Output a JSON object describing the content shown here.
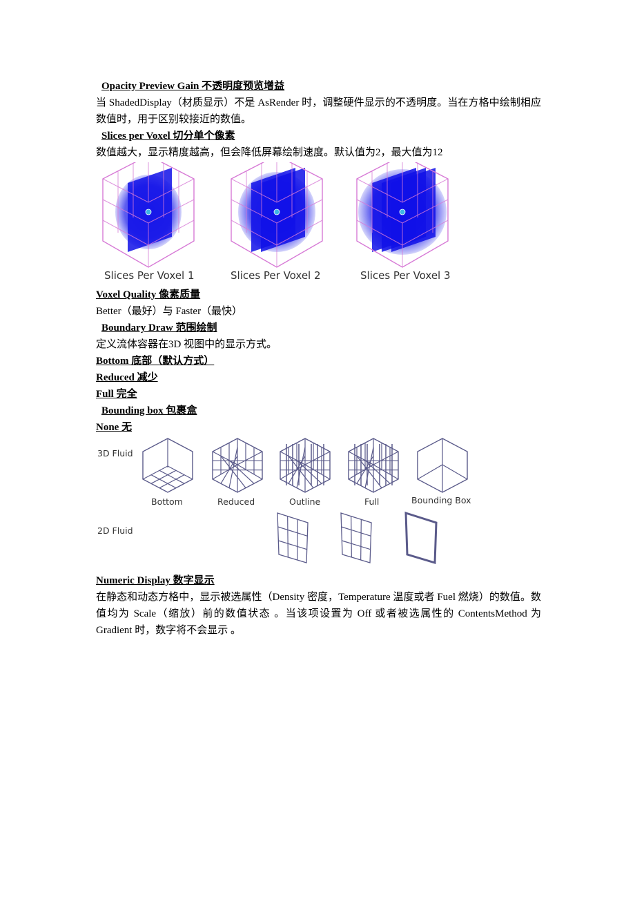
{
  "sections": {
    "opacity_gain": {
      "heading": "Opacity Preview Gain  不透明度预览增益",
      "text": "当 ShadedDisplay（材质显示）不是 AsRender 时，调整硬件显示的不透明度。当在方格中绘制相应数值时，用于区别较接近的数值。"
    },
    "slices_per_voxel": {
      "heading": "Slices per Voxel  切分单个像素",
      "text": "数值越大，显示精度越高，但会降低屏幕绘制速度。默认值为2，最大值为12"
    },
    "voxel_quality": {
      "heading": "Voxel Quality  像素质量",
      "text": "Better（最好）与 Faster（最快）"
    },
    "boundary_draw": {
      "heading": "Boundary Draw 范围绘制",
      "text": "定义流体容器在3D 视图中的显示方式。",
      "options": [
        "Bottom  底部（默认方式）",
        "Reduced  减少",
        "Full  完全",
        "Bounding box  包裹盒",
        "None  无"
      ]
    },
    "numeric_display": {
      "heading": "Numeric Display  数字显示",
      "text": "在静态和动态方格中，显示被选属性（Density 密度，Temperature 温度或者 Fuel 燃烧）的数值。数值均为 Scale（缩放）前的数值状态 。当该项设置为 Off 或者被选属性的 ContentsMethod 为 Gradient 时，数字将不会显示 。"
    }
  },
  "figure_slices": {
    "captions": [
      "Slices Per Voxel 1",
      "Slices Per Voxel 2",
      "Slices Per Voxel 3"
    ],
    "slice_counts": [
      1,
      2,
      3
    ],
    "colors": {
      "cage": "#d77ad6",
      "volume": "#1010e8",
      "center": "#3fb6e6"
    }
  },
  "figure_boundary": {
    "row_labels": [
      "3D Fluid",
      "2D Fluid"
    ],
    "captions": [
      "Bottom",
      "Reduced",
      "Outline",
      "Full",
      "Bounding Box"
    ],
    "colors": {
      "wire": "#5a5a8a"
    }
  }
}
